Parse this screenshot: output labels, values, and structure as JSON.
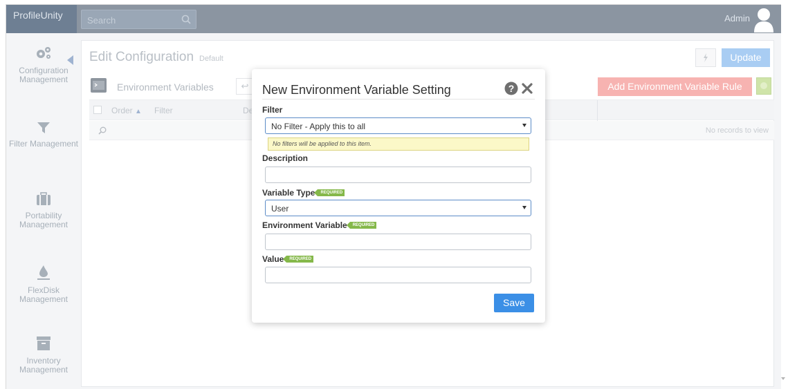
{
  "topbar": {
    "brand": "ProfileUnity",
    "search_placeholder": "Search",
    "user_name": "Admin"
  },
  "sidebar": {
    "items": [
      {
        "label": "Configuration Management",
        "icon": "gears-icon"
      },
      {
        "label": "Filter Management",
        "icon": "filter-icon"
      },
      {
        "label": "Portability Management",
        "icon": "briefcase-icon"
      },
      {
        "label": "FlexDisk Management",
        "icon": "flexdisk-icon"
      },
      {
        "label": "Inventory Management",
        "icon": "archive-icon"
      }
    ]
  },
  "page": {
    "title": "Edit Configuration",
    "subtitle": "Default",
    "update_label": "Update"
  },
  "section": {
    "title": "Environment Variables",
    "add_rule_label": "Add Environment Variable Rule"
  },
  "grid": {
    "columns": [
      "Order",
      "Filter",
      "Des"
    ],
    "empty_message": "No records to view"
  },
  "modal": {
    "title": "New Environment Variable Setting",
    "filter_label": "Filter",
    "filter_value": "No Filter - Apply this to all",
    "filter_hint": "No filters will be applied to this item.",
    "description_label": "Description",
    "description_value": "",
    "variable_type_label": "Variable Type",
    "variable_type_value": "User",
    "env_variable_label": "Environment Variable",
    "env_variable_value": "",
    "value_label": "Value",
    "value_value": "",
    "required_badge": "REQUIRED",
    "save_label": "Save"
  },
  "colors": {
    "topbar": "#8b95a1",
    "accent": "#3b8fe6",
    "required": "#85b84a",
    "add_rule": "#f7b3b1"
  }
}
